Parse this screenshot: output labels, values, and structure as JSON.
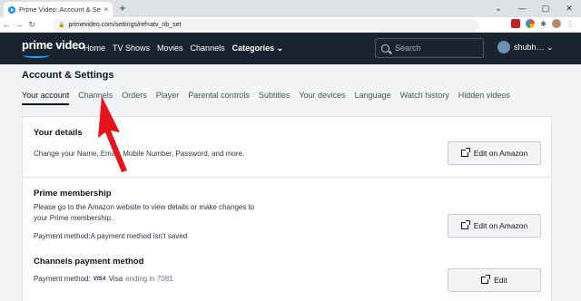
{
  "browser": {
    "tab_title": "Prime Video: Account & Settings",
    "tab_close": "×",
    "new_tab": "+",
    "url": "primevideo.com/settings/ref=atv_nb_set",
    "window_buttons": [
      "⌄",
      "—",
      "▢",
      "✕"
    ],
    "nav_buttons": [
      "←",
      "→",
      "↻"
    ]
  },
  "header": {
    "logo": "prime video",
    "nav_items": [
      "Home",
      "TV Shows",
      "Movies",
      "Channels",
      "Categories ⌄"
    ],
    "search_placeholder": "Search",
    "user_name": "shubh… ⌄"
  },
  "page": {
    "title": "Account & Settings",
    "tabs": [
      "Your account",
      "Channels",
      "Orders",
      "Player",
      "Parental controls",
      "Subtitles",
      "Your devices",
      "Language",
      "Watch history",
      "Hidden videos"
    ]
  },
  "sections": {
    "details": {
      "title": "Your details",
      "text": "Change your Name, Email, Mobile Number, Password, and more.",
      "button": "Edit on Amazon"
    },
    "membership": {
      "title": "Prime membership",
      "text1": "Please go to the Amazon website to view details or make changes to",
      "text2": "your Prime membership.",
      "payment": "Payment method:A payment method isn't saved",
      "button": "Edit on Amazon"
    },
    "channels": {
      "title": "Channels payment method",
      "label": "Payment method:",
      "card_logo": "VISA",
      "card_brand": "Visa",
      "card_ending": "ending in 7081",
      "button": "Edit"
    }
  },
  "colors": {
    "header_bg": "#1a242f",
    "accent_blue": "#1ea1ff",
    "annotation_arrow": "#e8141c"
  }
}
